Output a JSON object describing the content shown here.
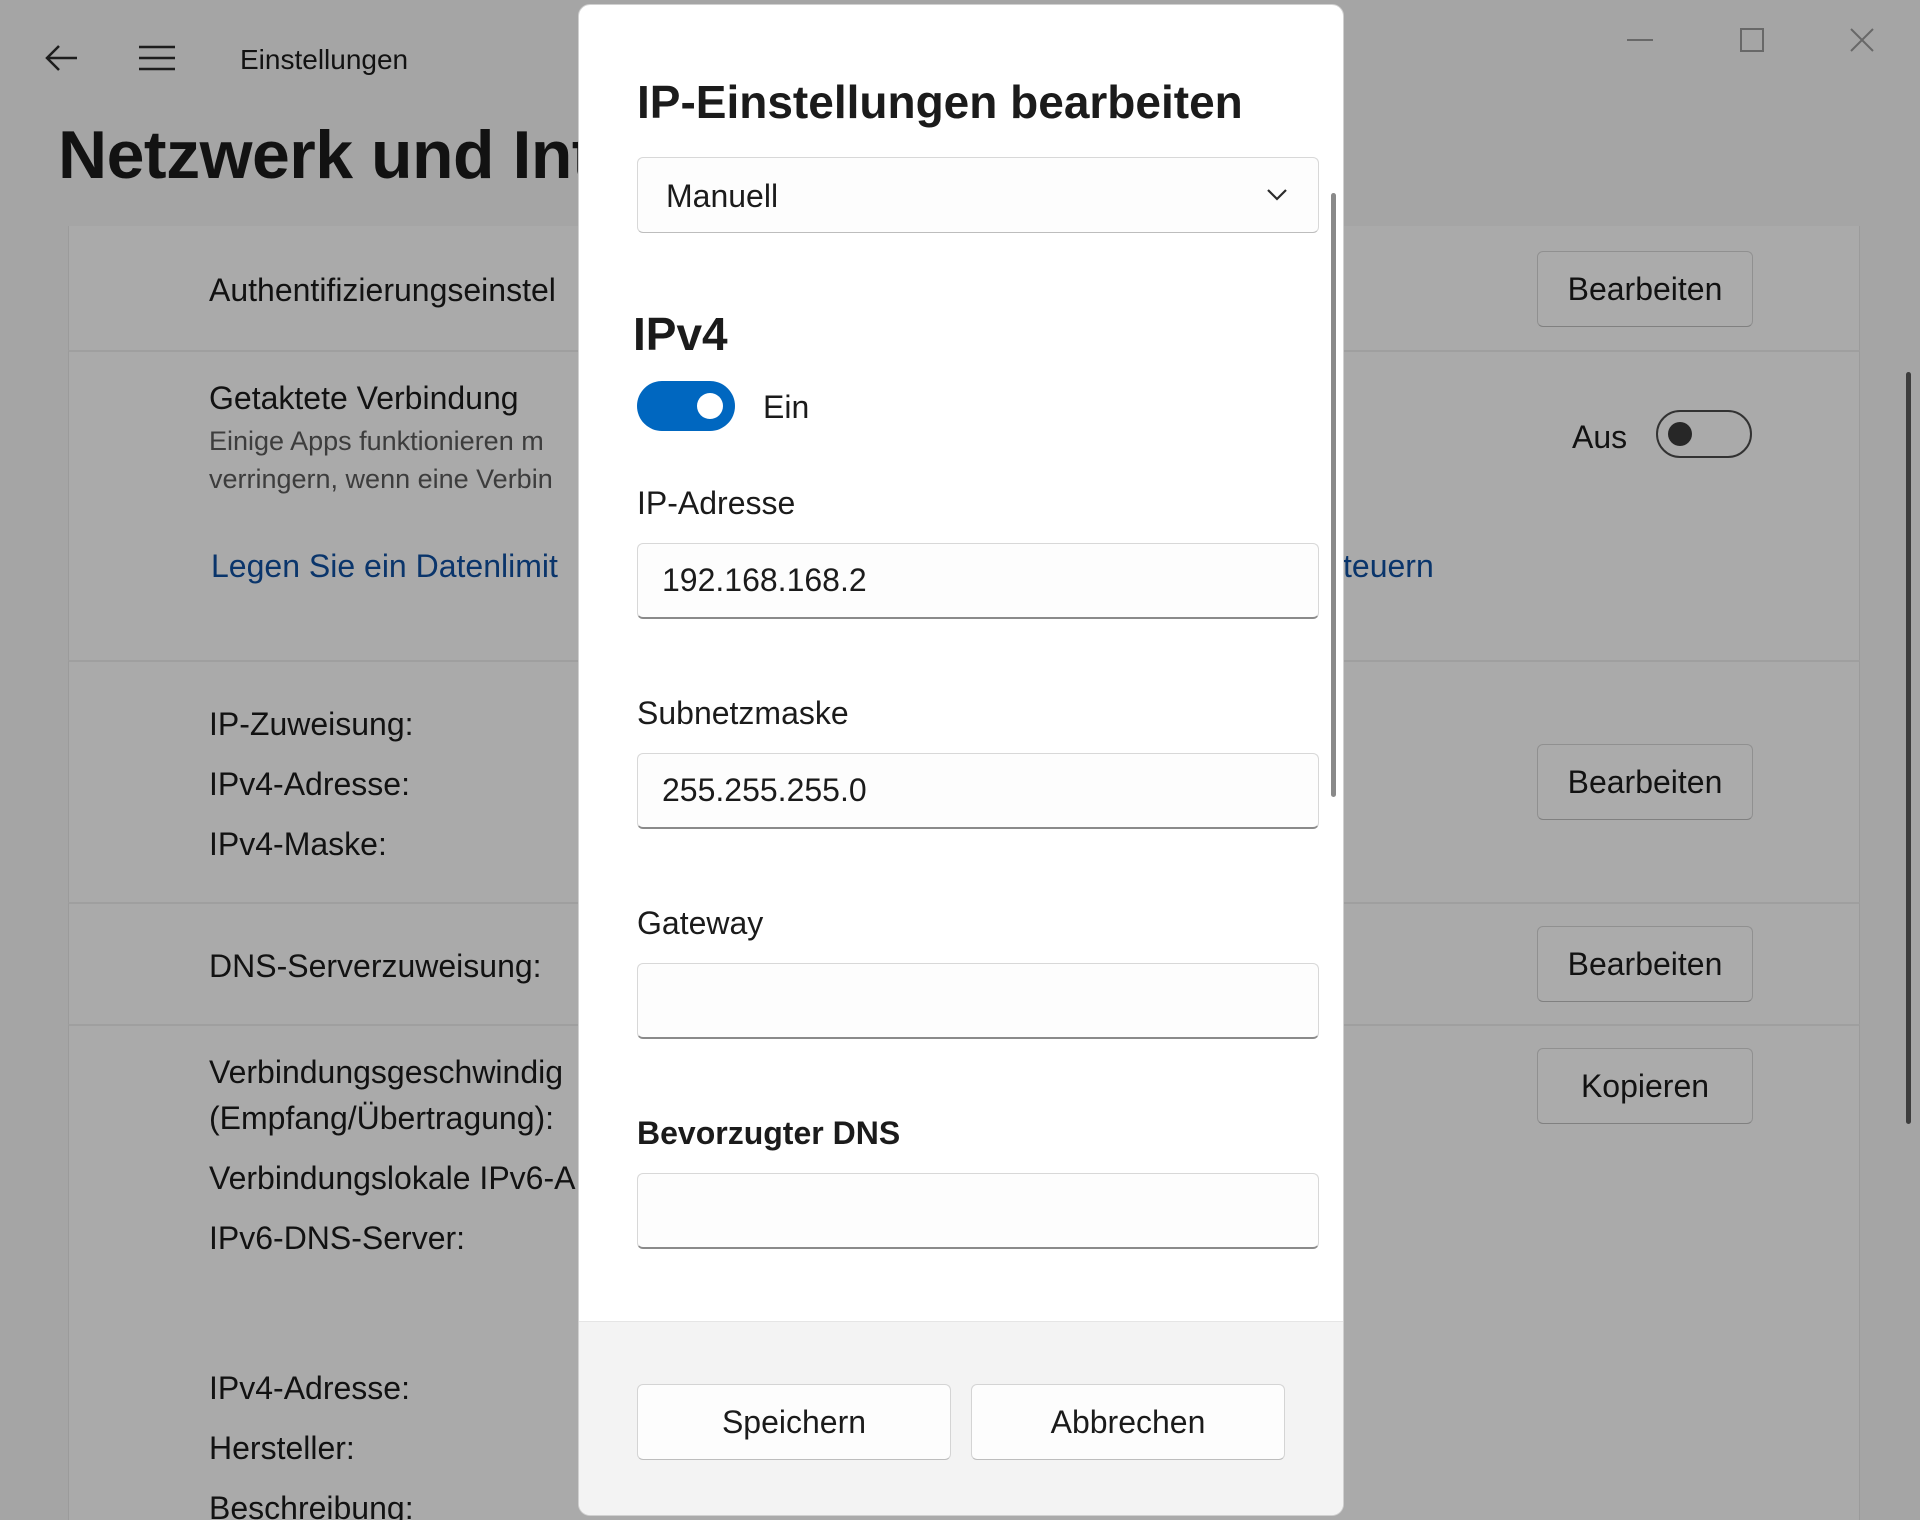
{
  "window": {
    "app_title": "Einstellungen",
    "page_title": "Netzwerk und Int",
    "icons": {
      "back": "arrow-left-icon",
      "menu": "hamburger-menu-icon",
      "minimize": "minimize-icon",
      "maximize": "maximize-icon",
      "close": "close-icon"
    },
    "auth_label": "Authentifizierungseinstel",
    "auth_button": "Bearbeiten",
    "metered_title": "Getaktete Verbindung",
    "metered_desc_1": "Einige Apps funktionieren m",
    "metered_desc_2": "verringern, wenn eine Verbin",
    "metered_state": "Aus",
    "metered_on": false,
    "data_limit_link": "Legen Sie ein Datenlimit",
    "data_limit_link_tail": "teuern",
    "ip_assignment_label": "IP-Zuweisung:",
    "ipv4_address_label": "IPv4-Adresse:",
    "ipv4_mask_label": "IPv4-Maske:",
    "ip_button": "Bearbeiten",
    "dns_label": "DNS-Serverzuweisung:",
    "dns_button": "Bearbeiten",
    "speed_label_1": "Verbindungsgeschwindig",
    "speed_label_2": "(Empfang/Übertragung):",
    "linklocal_label": "Verbindungslokale IPv6-A",
    "ipv6_dns_label": "IPv6-DNS-Server:",
    "copy_button": "Kopieren",
    "ipv4_address_label_2": "IPv4-Adresse:",
    "manufacturer_label": "Hersteller:",
    "description_label": "Beschreibung:"
  },
  "dialog": {
    "title": "IP-Einstellungen bearbeiten",
    "mode_selected": "Manuell",
    "section_title": "IPv4",
    "ipv4_toggle_label": "Ein",
    "ipv4_enabled": true,
    "fields": {
      "ip_address": {
        "label": "IP-Adresse",
        "value": "192.168.168.2"
      },
      "subnet_mask": {
        "label": "Subnetzmaske",
        "value": "255.255.255.0"
      },
      "gateway": {
        "label": "Gateway",
        "value": ""
      },
      "preferred_dns": {
        "label": "Bevorzugter DNS",
        "value": ""
      }
    },
    "save_button": "Speichern",
    "cancel_button": "Abbrechen"
  },
  "colors": {
    "accent": "#0067c0",
    "link": "#0f4f9e"
  }
}
